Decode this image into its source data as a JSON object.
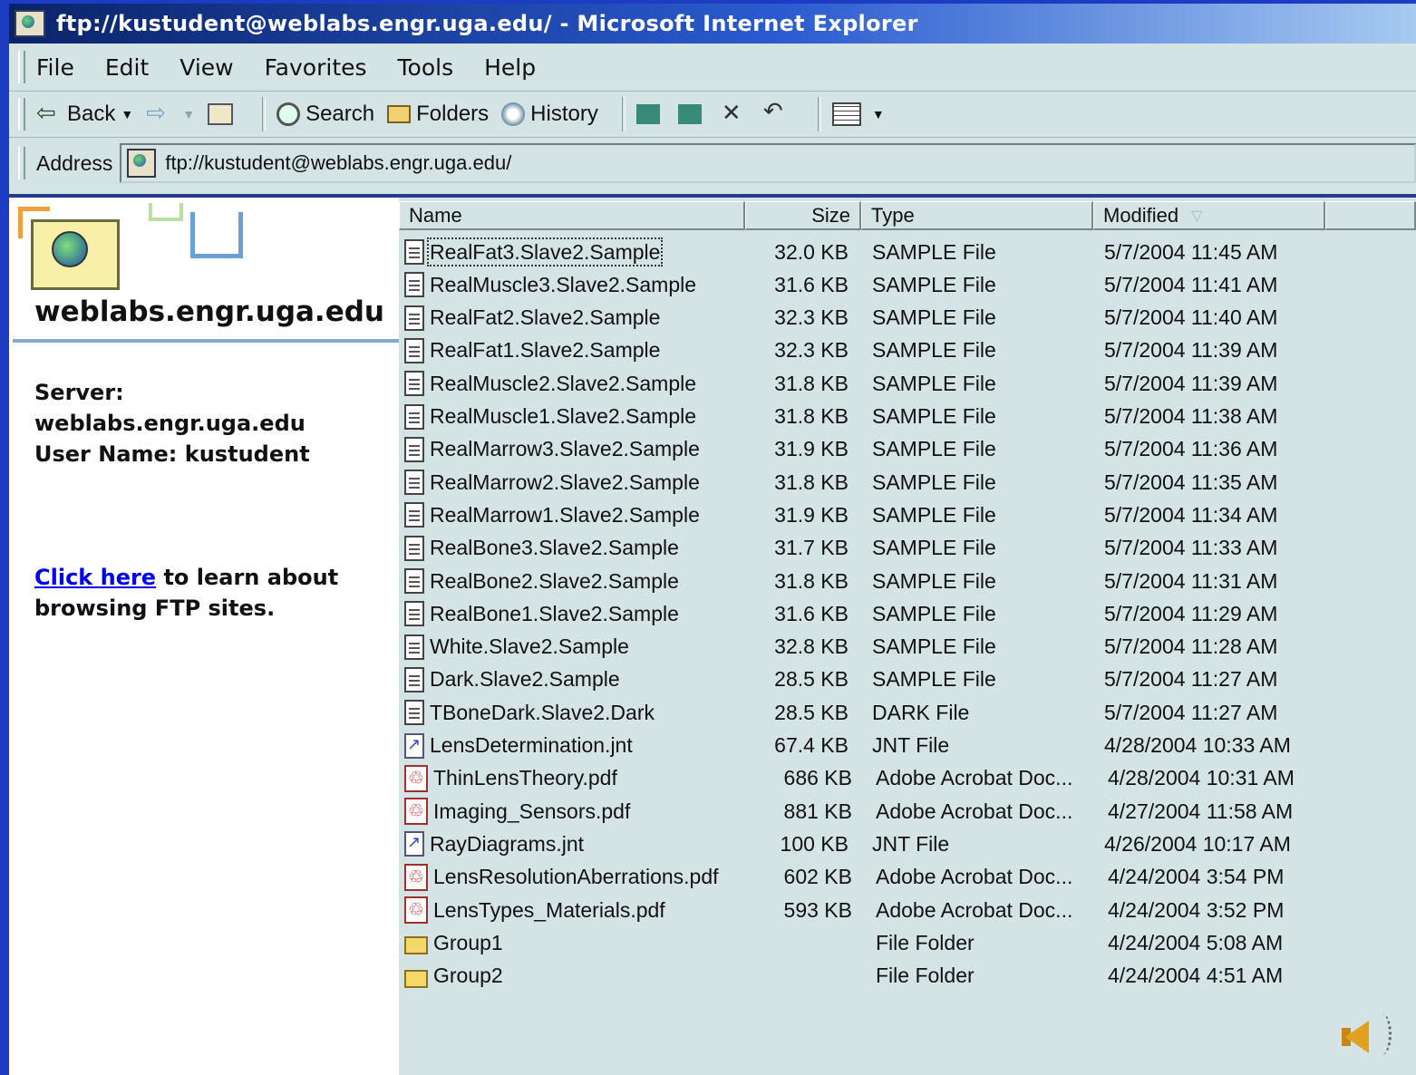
{
  "window": {
    "title": "ftp://kustudent@weblabs.engr.uga.edu/ - Microsoft Internet Explorer"
  },
  "menu": [
    "File",
    "Edit",
    "View",
    "Favorites",
    "Tools",
    "Help"
  ],
  "toolbar": {
    "back": "Back",
    "search": "Search",
    "folders": "Folders",
    "history": "History"
  },
  "address": {
    "label": "Address",
    "url": "ftp://kustudent@weblabs.engr.uga.edu/"
  },
  "left_panel": {
    "host": "weblabs.engr.uga.edu",
    "server_label": "Server:",
    "server_value": "weblabs.engr.uga.edu",
    "user_line": "User Name: kustudent",
    "link_text": "Click here",
    "help_text": " to learn about browsing FTP sites."
  },
  "columns": {
    "name": "Name",
    "size": "Size",
    "type": "Type",
    "modified": "Modified"
  },
  "files": [
    {
      "icon": "file",
      "name": "RealFat3.Slave2.Sample",
      "size": "32.0 KB",
      "type": "SAMPLE File",
      "modified": "5/7/2004 11:45 AM",
      "selected": true
    },
    {
      "icon": "file",
      "name": "RealMuscle3.Slave2.Sample",
      "size": "31.6 KB",
      "type": "SAMPLE File",
      "modified": "5/7/2004 11:41 AM"
    },
    {
      "icon": "file",
      "name": "RealFat2.Slave2.Sample",
      "size": "32.3 KB",
      "type": "SAMPLE File",
      "modified": "5/7/2004 11:40 AM"
    },
    {
      "icon": "file",
      "name": "RealFat1.Slave2.Sample",
      "size": "32.3 KB",
      "type": "SAMPLE File",
      "modified": "5/7/2004 11:39 AM"
    },
    {
      "icon": "file",
      "name": "RealMuscle2.Slave2.Sample",
      "size": "31.8 KB",
      "type": "SAMPLE File",
      "modified": "5/7/2004 11:39 AM"
    },
    {
      "icon": "file",
      "name": "RealMuscle1.Slave2.Sample",
      "size": "31.8 KB",
      "type": "SAMPLE File",
      "modified": "5/7/2004 11:38 AM"
    },
    {
      "icon": "file",
      "name": "RealMarrow3.Slave2.Sample",
      "size": "31.9 KB",
      "type": "SAMPLE File",
      "modified": "5/7/2004 11:36 AM"
    },
    {
      "icon": "file",
      "name": "RealMarrow2.Slave2.Sample",
      "size": "31.8 KB",
      "type": "SAMPLE File",
      "modified": "5/7/2004 11:35 AM"
    },
    {
      "icon": "file",
      "name": "RealMarrow1.Slave2.Sample",
      "size": "31.9 KB",
      "type": "SAMPLE File",
      "modified": "5/7/2004 11:34 AM"
    },
    {
      "icon": "file",
      "name": "RealBone3.Slave2.Sample",
      "size": "31.7 KB",
      "type": "SAMPLE File",
      "modified": "5/7/2004 11:33 AM"
    },
    {
      "icon": "file",
      "name": "RealBone2.Slave2.Sample",
      "size": "31.8 KB",
      "type": "SAMPLE File",
      "modified": "5/7/2004 11:31 AM"
    },
    {
      "icon": "file",
      "name": "RealBone1.Slave2.Sample",
      "size": "31.6 KB",
      "type": "SAMPLE File",
      "modified": "5/7/2004 11:29 AM"
    },
    {
      "icon": "file",
      "name": "White.Slave2.Sample",
      "size": "32.8 KB",
      "type": "SAMPLE File",
      "modified": "5/7/2004 11:28 AM"
    },
    {
      "icon": "file",
      "name": "Dark.Slave2.Sample",
      "size": "28.5 KB",
      "type": "SAMPLE File",
      "modified": "5/7/2004 11:27 AM"
    },
    {
      "icon": "file",
      "name": "TBoneDark.Slave2.Dark",
      "size": "28.5 KB",
      "type": "DARK File",
      "modified": "5/7/2004 11:27 AM"
    },
    {
      "icon": "jnt",
      "name": "LensDetermination.jnt",
      "size": "67.4 KB",
      "type": "JNT File",
      "modified": "4/28/2004 10:33 AM"
    },
    {
      "icon": "pdf",
      "name": "ThinLensTheory.pdf",
      "size": "686 KB",
      "type": "Adobe Acrobat Doc...",
      "modified": "4/28/2004 10:31 AM"
    },
    {
      "icon": "pdf",
      "name": "Imaging_Sensors.pdf",
      "size": "881 KB",
      "type": "Adobe Acrobat Doc...",
      "modified": "4/27/2004 11:58 AM"
    },
    {
      "icon": "jnt",
      "name": "RayDiagrams.jnt",
      "size": "100 KB",
      "type": "JNT File",
      "modified": "4/26/2004 10:17 AM"
    },
    {
      "icon": "pdf",
      "name": "LensResolutionAberrations.pdf",
      "size": "602 KB",
      "type": "Adobe Acrobat Doc...",
      "modified": "4/24/2004 3:54 PM"
    },
    {
      "icon": "pdf",
      "name": "LensTypes_Materials.pdf",
      "size": "593 KB",
      "type": "Adobe Acrobat Doc...",
      "modified": "4/24/2004 3:52 PM"
    },
    {
      "icon": "folder",
      "name": "Group1",
      "size": "",
      "type": "File Folder",
      "modified": "4/24/2004 5:08 AM"
    },
    {
      "icon": "folder",
      "name": "Group2",
      "size": "",
      "type": "File Folder",
      "modified": "4/24/2004 4:51 AM"
    }
  ]
}
